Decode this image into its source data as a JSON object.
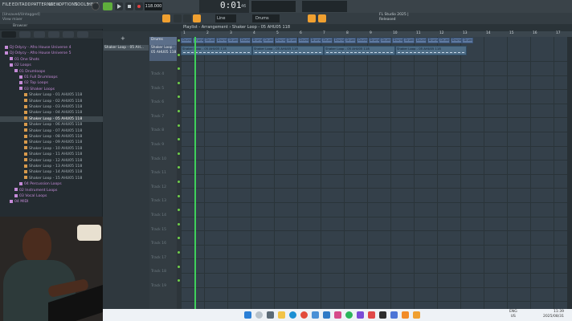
{
  "menu": {
    "items": [
      "FILE",
      "EDIT",
      "ADD",
      "PATTERNS",
      "VIEW",
      "OPTIONS",
      "TOOLS",
      "HELP"
    ]
  },
  "transport": {
    "tempo": "118.000",
    "time_main": "0:01",
    "time_sub": "46",
    "pattern_label": "Line",
    "channel_label": "Drums"
  },
  "toolbar": {
    "hint_text": "[Unsaved/Untagged]",
    "view_label": "View mixer",
    "project_title": "FL Studio 2025 |",
    "project_sub": "Released"
  },
  "browser": {
    "label": "Browser",
    "items": [
      {
        "label": "DJ Odycy - Afro House Universe 4",
        "type": "folder",
        "indent": 1
      },
      {
        "label": "DJ Odycy - Afro House Universe 5",
        "type": "folder",
        "indent": 1
      },
      {
        "label": "01 One Shots",
        "type": "folder",
        "indent": 2
      },
      {
        "label": "02 Loops",
        "type": "folder",
        "indent": 2
      },
      {
        "label": "01 Drumloops",
        "type": "folder",
        "indent": 3
      },
      {
        "label": "01 Full Drumloops",
        "type": "folder",
        "indent": 4
      },
      {
        "label": "02 Top Loops",
        "type": "folder",
        "indent": 4
      },
      {
        "label": "03 Shaker Loops",
        "type": "folder",
        "indent": 4
      },
      {
        "label": "Shaker Loop - 01 AHU05 118",
        "type": "file",
        "indent": 5
      },
      {
        "label": "Shaker Loop - 02 AHU05 118",
        "type": "file",
        "indent": 5
      },
      {
        "label": "Shaker Loop - 03 AHU05 118",
        "type": "file",
        "indent": 5
      },
      {
        "label": "Shaker Loop - 04 AHU05 118",
        "type": "file",
        "indent": 5
      },
      {
        "label": "Shaker Loop - 05 AHU05 118",
        "type": "file",
        "indent": 5,
        "selected": true
      },
      {
        "label": "Shaker Loop - 06 AHU05 118",
        "type": "file",
        "indent": 5
      },
      {
        "label": "Shaker Loop - 07 AHU05 118",
        "type": "file",
        "indent": 5
      },
      {
        "label": "Shaker Loop - 08 AHU05 118",
        "type": "file",
        "indent": 5
      },
      {
        "label": "Shaker Loop - 09 AHU05 118",
        "type": "file",
        "indent": 5
      },
      {
        "label": "Shaker Loop - 10 AHU05 118",
        "type": "file",
        "indent": 5
      },
      {
        "label": "Shaker Loop - 11 AHU05 118",
        "type": "file",
        "indent": 5
      },
      {
        "label": "Shaker Loop - 12 AHU05 118",
        "type": "file",
        "indent": 5
      },
      {
        "label": "Shaker Loop - 13 AHU05 118",
        "type": "file",
        "indent": 5
      },
      {
        "label": "Shaker Loop - 14 AHU05 118",
        "type": "file",
        "indent": 5
      },
      {
        "label": "Shaker Loop - 15 AHU05 118",
        "type": "file",
        "indent": 5
      },
      {
        "label": "04 Percussion Loops",
        "type": "folder",
        "indent": 4
      },
      {
        "label": "02 Instrument Loops",
        "type": "folder",
        "indent": 3
      },
      {
        "label": "03 Vocal Loops",
        "type": "folder",
        "indent": 3
      },
      {
        "label": "04 MIDI",
        "type": "folder",
        "indent": 2
      }
    ]
  },
  "playlist": {
    "breadcrumb": "Playlist - Arrangement › Shaker Loop - 05 AHU05 118",
    "pattern_item": "Shaker Loop - 05 AH...",
    "ruler": [
      "1",
      "2",
      "3",
      "4",
      "5",
      "6",
      "7",
      "8",
      "9",
      "10",
      "11",
      "12",
      "13",
      "14",
      "15",
      "16",
      "17"
    ],
    "track1_name": "Drums",
    "track2_name": "Shaker Loop - 05 AHU05 118",
    "track_labels": [
      "Track 4",
      "Track 5",
      "Track 6",
      "Track 7",
      "Track 8",
      "Track 9",
      "Track 10",
      "Track 11",
      "Track 12",
      "Track 13",
      "Track 14",
      "Track 15",
      "Track 16",
      "Track 17",
      "Track 18",
      "Track 19"
    ],
    "drum_clip_label": "Drums",
    "audio_clip_label": "Shaker Loop - 05 AHU05 118"
  },
  "taskbar": {
    "lang": "ENG",
    "region": "US",
    "time": "11:39",
    "date": "2025/08/31"
  },
  "colors": {
    "accent": "#f0a030",
    "playhead": "#3fd05a",
    "folder": "#c58bd8",
    "clip": "#5f7aa1"
  }
}
